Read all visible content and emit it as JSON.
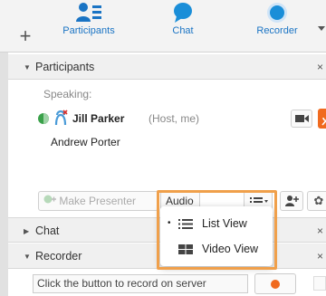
{
  "toolbar": {
    "add_label": "+",
    "items": [
      {
        "label": "Participants",
        "icon": "participants-icon"
      },
      {
        "label": "Chat",
        "icon": "chat-bubble-icon"
      },
      {
        "label": "Recorder",
        "icon": "recorder-icon"
      }
    ],
    "accent_color": "#1a74c4"
  },
  "participants_section": {
    "title": "Participants",
    "close": "×",
    "speaking_label": "Speaking:",
    "participants": [
      {
        "name": "Jill Parker",
        "role": "(Host, me)"
      },
      {
        "name": "Andrew Porter",
        "role": ""
      }
    ],
    "make_presenter_label": "Make Presenter",
    "audio_label": "Audio"
  },
  "view_menu": {
    "items": [
      {
        "label": "List View",
        "icon": "list-view-icon",
        "selected": true
      },
      {
        "label": "Video View",
        "icon": "video-view-icon",
        "selected": false
      }
    ],
    "selected_marker": "•",
    "highlight_color": "#f0a04b"
  },
  "chat_section": {
    "title": "Chat",
    "close": "×"
  },
  "recorder_section": {
    "title": "Recorder",
    "close": "×",
    "field_text": "Click the button to record on server",
    "record_color": "#f06a1f"
  },
  "icons": {
    "gear": "✿",
    "collapse": "▼",
    "expand": "▶"
  }
}
